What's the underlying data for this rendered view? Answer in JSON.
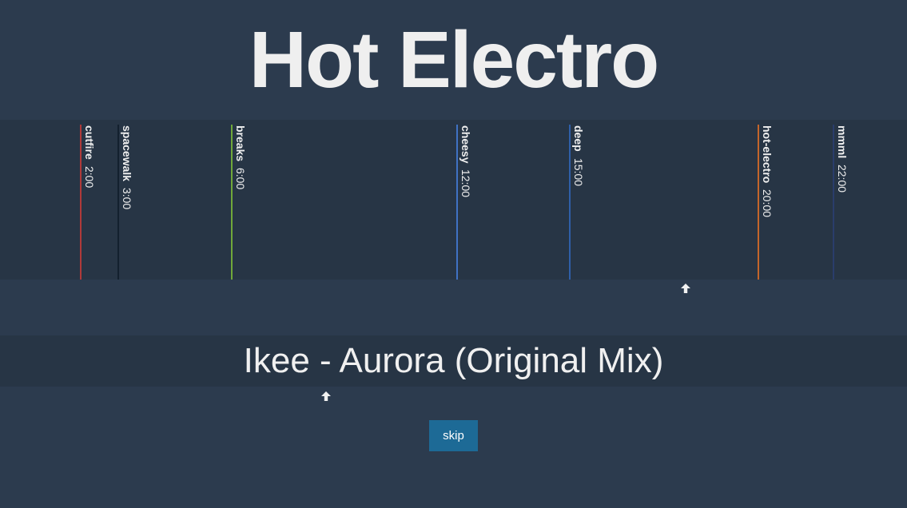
{
  "header": {
    "title": "Hot Electro"
  },
  "timeline": {
    "markers": [
      {
        "name": "cutfire",
        "time": "2:00",
        "color": "#b03a3a"
      },
      {
        "name": "spacewalk",
        "time": "3:00",
        "color": "#13202e"
      },
      {
        "name": "breaks",
        "time": "6:00",
        "color": "#6fa83a"
      },
      {
        "name": "cheesy",
        "time": "12:00",
        "color": "#3f72c4"
      },
      {
        "name": "deep",
        "time": "15:00",
        "color": "#2f5fa8"
      },
      {
        "name": "hot-electro",
        "time": "20:00",
        "color": "#c4652a"
      },
      {
        "name": "mmml",
        "time": "22:00",
        "color": "#2a3d6b"
      }
    ]
  },
  "player": {
    "track_title": "Ikee - Aurora (Original Mix)",
    "skip_label": "skip"
  },
  "icons": {
    "position_arrow": "arrow-up-icon"
  }
}
